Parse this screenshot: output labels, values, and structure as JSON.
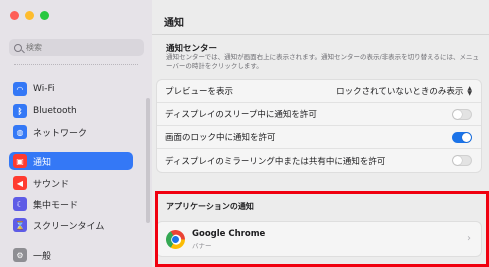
{
  "sidebar": {
    "search_placeholder": "検索",
    "items": [
      {
        "label": "Wi-Fi",
        "icon": "wifi-icon",
        "icon_color": "#3478f6",
        "glyph": "◠"
      },
      {
        "label": "Bluetooth",
        "icon": "bluetooth-icon",
        "icon_color": "#3478f6",
        "glyph": "ᛒ"
      },
      {
        "label": "ネットワーク",
        "icon": "globe-icon",
        "icon_color": "#3478f6",
        "glyph": "◍"
      },
      {
        "label": "通知",
        "icon": "bell-icon",
        "icon_color": "#ff3b30",
        "glyph": "▣",
        "active": true
      },
      {
        "label": "サウンド",
        "icon": "speaker-icon",
        "icon_color": "#ff3b30",
        "glyph": "◀"
      },
      {
        "label": "集中モード",
        "icon": "moon-icon",
        "icon_color": "#5e5ce6",
        "glyph": "☾"
      },
      {
        "label": "スクリーンタイム",
        "icon": "hourglass-icon",
        "icon_color": "#5e5ce6",
        "glyph": "⌛"
      },
      {
        "label": "一般",
        "icon": "gear-icon",
        "icon_color": "#8e8e93",
        "glyph": "⚙"
      }
    ],
    "accent": "#3478f6"
  },
  "main": {
    "title": "通知",
    "notification_center": {
      "heading": "通知センター",
      "description": "通知センターでは、通知が画面右上に表示されます。通知センターの表示/非表示を切り替えるには、メニューバーの時計をクリックします。"
    },
    "settings": [
      {
        "label": "プレビューを表示",
        "type": "popup",
        "value": "ロックされていないときのみ表示"
      },
      {
        "label": "ディスプレイのスリープ中に通知を許可",
        "type": "toggle",
        "on": false
      },
      {
        "label": "画面のロック中に通知を許可",
        "type": "toggle",
        "on": true
      },
      {
        "label": "ディスプレイのミラーリング中または共有中に通知を許可",
        "type": "toggle",
        "on": false
      }
    ],
    "app_notifications": {
      "heading": "アプリケーションの通知",
      "apps": [
        {
          "name": "Google Chrome",
          "subtitle": "バナー",
          "icon": "chrome-icon"
        }
      ]
    }
  },
  "highlight_color": "#f0000f"
}
